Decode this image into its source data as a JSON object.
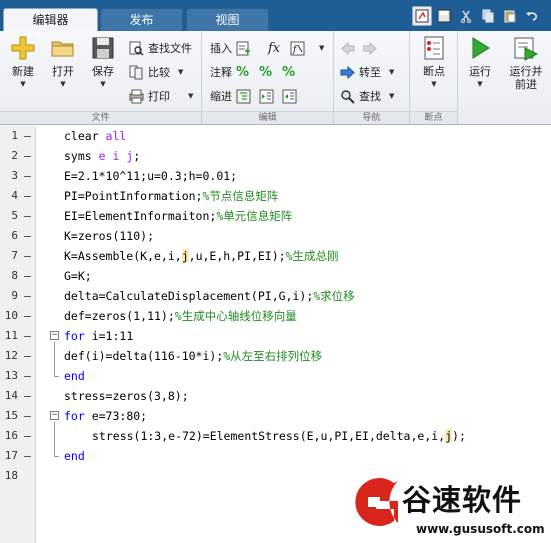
{
  "tabs": [
    {
      "label": "编辑器",
      "active": true
    },
    {
      "label": "发布",
      "active": false
    },
    {
      "label": "视图",
      "active": false
    }
  ],
  "ribbon": {
    "file_section": {
      "label": "文件",
      "new_label": "新建",
      "open_label": "打开",
      "save_label": "保存",
      "find_files_label": "查找文件",
      "compare_label": "比较",
      "print_label": "打印"
    },
    "edit_section": {
      "label": "编辑",
      "insert_label": "插入",
      "comment_label": "注释",
      "indent_label": "缩进"
    },
    "navigate_section": {
      "label": "导航",
      "goto_label": "转至",
      "find_label": "查找"
    },
    "breakpoint_section": {
      "label": "断点",
      "breakpoints_label": "断点"
    },
    "run_section": {
      "run_label": "运行",
      "run_advance_label_1": "运行并",
      "run_advance_label_2": "前进"
    }
  },
  "editor": {
    "lines": [
      {
        "n": "1",
        "dash": "–"
      },
      {
        "n": "2",
        "dash": "–"
      },
      {
        "n": "3",
        "dash": "–"
      },
      {
        "n": "4",
        "dash": "–"
      },
      {
        "n": "5",
        "dash": "–"
      },
      {
        "n": "6",
        "dash": "–"
      },
      {
        "n": "7",
        "dash": "–"
      },
      {
        "n": "8",
        "dash": "–"
      },
      {
        "n": "9",
        "dash": "–"
      },
      {
        "n": "10",
        "dash": "–"
      },
      {
        "n": "11",
        "dash": "–"
      },
      {
        "n": "12",
        "dash": "–"
      },
      {
        "n": "13",
        "dash": "–"
      },
      {
        "n": "14",
        "dash": "–"
      },
      {
        "n": "15",
        "dash": "–"
      },
      {
        "n": "16",
        "dash": "–"
      },
      {
        "n": "17",
        "dash": "–"
      },
      {
        "n": "18",
        "dash": ""
      }
    ],
    "code": {
      "l1_kw": "clear",
      "l1_rest": " all",
      "l2_a": "syms ",
      "l2_b": "e i j",
      "l3": "E=2.1*10^11;u=0.3;h=0.01;",
      "l4_code": "PI=PointInformation;",
      "l4_cm": "%节点信息矩阵",
      "l5_code": "EI=ElementInformaiton;",
      "l5_cm": "%单元信息矩阵",
      "l6": "K=zeros(110);",
      "l7_a": "K=Assemble(K,e,i,",
      "l7_hl": "j",
      "l7_b": ",u,E,h,PI,EI);",
      "l7_cm": "%生成总刚",
      "l8": "G=K;",
      "l9_code": "delta=CalculateDisplacement(PI,G,i);",
      "l9_cm": "%求位移",
      "l10_code": "def=zeros(1,11);",
      "l10_cm": "%生成中心轴线位移向量",
      "l11_kw": "for",
      "l11_rest": " i=1:11",
      "l12_code": "def(i)=delta(116-10*i);",
      "l12_cm": "%从左至右排列位移",
      "l13_kw": "end",
      "l14": "stress=zeros(3,8);",
      "l15_kw": "for",
      "l15_rest": " e=73:80;",
      "l16_a": "stress(1:3,e-72)=ElementStress(E,u,PI,EI,delta,e,i,",
      "l16_hl": "j",
      "l16_b": ");",
      "l17_kw": "end"
    }
  },
  "watermark": {
    "title": "谷速软件",
    "url": "www.gususoft.com"
  },
  "colors": {
    "keyword": "#0000ff",
    "comment": "#228b22",
    "string": "#a020f0",
    "tabbar": "#1f5d96",
    "watermark_red": "#d9261c"
  }
}
